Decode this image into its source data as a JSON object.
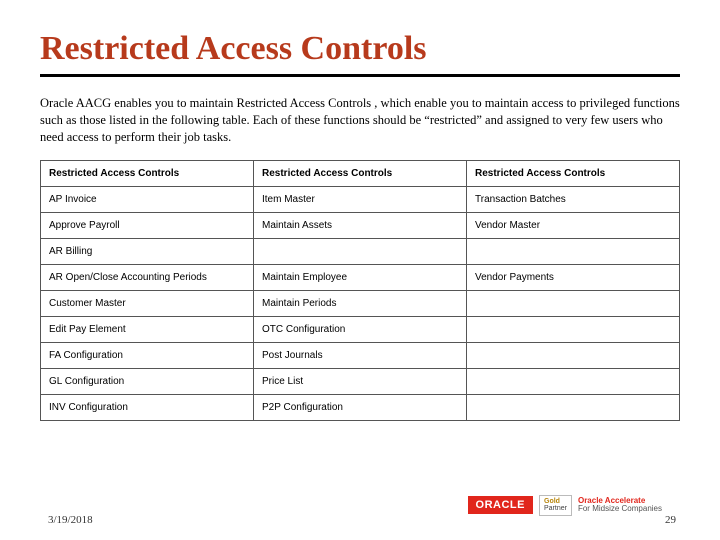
{
  "title": "Restricted Access Controls",
  "intro": "Oracle AACG enables you to maintain Restricted Access Controls , which enable you to maintain access to privileged functions such as those listed in the following table.  Each of these functions should be “restricted” and assigned to very few users who need access to perform their job tasks.",
  "table": {
    "headers": [
      "Restricted Access Controls",
      "Restricted Access Controls",
      "Restricted Access Controls"
    ],
    "rows": [
      [
        "AP Invoice",
        "Item Master",
        "Transaction Batches"
      ],
      [
        "Approve Payroll",
        "Maintain Assets",
        "Vendor Master"
      ],
      [
        "AR Billing",
        "",
        ""
      ],
      [
        "AR Open/Close Accounting Periods",
        "Maintain Employee",
        "Vendor Payments"
      ],
      [
        "Customer Master",
        "Maintain Periods",
        ""
      ],
      [
        "Edit Pay Element",
        "OTC Configuration",
        ""
      ],
      [
        "FA Configuration",
        "Post Journals",
        ""
      ],
      [
        "GL Configuration",
        "Price List",
        ""
      ],
      [
        "INV Configuration",
        "P2P Configuration",
        ""
      ]
    ]
  },
  "footer": {
    "date": "3/19/2018",
    "page": "29",
    "oracle": "ORACLE",
    "partner_line1": "Gold",
    "partner_line2": "Partner",
    "accelerate_line1": "Oracle Accelerate",
    "accelerate_line2": "For Midsize Companies"
  }
}
